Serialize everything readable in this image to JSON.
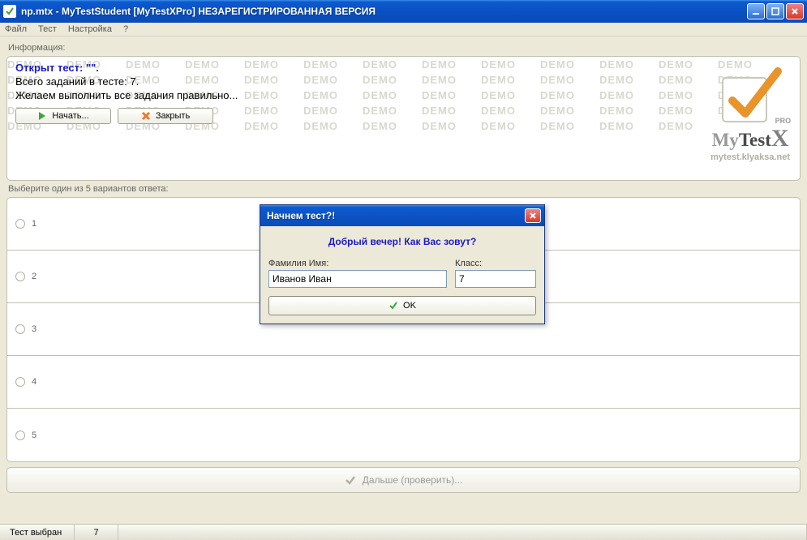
{
  "titlebar": {
    "title": "np.mtx - MyTestStudent [MyTestXPro] НЕЗАРЕГИСТРИРОВАННАЯ ВЕРСИЯ"
  },
  "menu": {
    "file": "Файл",
    "test": "Тест",
    "settings": "Настройка",
    "help": "?"
  },
  "info": {
    "label": "Информация:",
    "opened": "Открыт тест: \"\".",
    "total": "Всего заданий в тесте: 7.",
    "wish": "Желаем выполнить все задания правильно...",
    "start_btn": "Начать...",
    "close_btn": "Закрыть",
    "demo_word": "DEMO"
  },
  "logo": {
    "pro": "PRO",
    "url": "mytest.klyaksa.net"
  },
  "answers": {
    "label": "Выберите один из 5 вариантов ответа:",
    "options": [
      "1",
      "2",
      "3",
      "4",
      "5"
    ]
  },
  "bottom": {
    "next": "Дальше (проверить)..."
  },
  "status": {
    "selected": "Тест выбран",
    "count": "7"
  },
  "dialog": {
    "title": "Начнем тест?!",
    "greeting": "Добрый вечер! Как Вас зовут?",
    "name_label": "Фамилия Имя:",
    "name_value": "Иванов Иван",
    "class_label": "Класс:",
    "class_value": "7",
    "ok": "OK"
  }
}
